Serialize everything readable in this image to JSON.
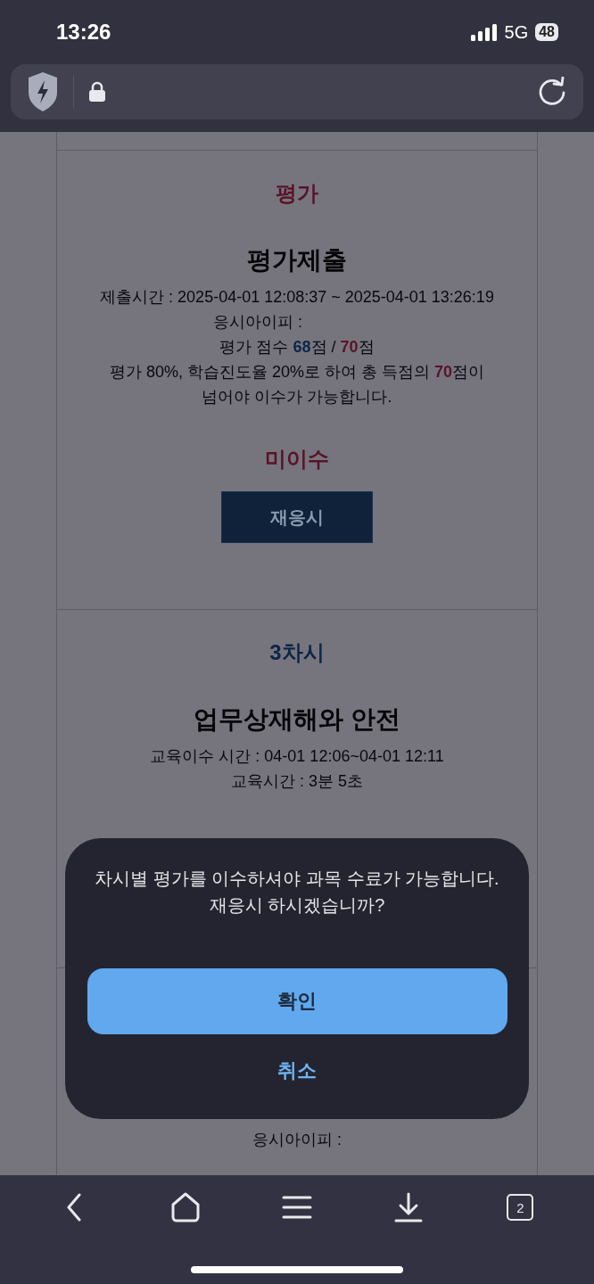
{
  "status_bar": {
    "time": "13:26",
    "network": "5G",
    "battery": "48"
  },
  "sections": [
    {
      "kind": "evaluation",
      "heading": "평가",
      "title": "평가제출",
      "lines": [
        "제출시간 : 2025-04-01 12:08:37 ~ 2025-04-01 13:26:19"
      ],
      "ip_label": "응시아이피 :",
      "score": "평가 점수 **68**점 / **70**점",
      "rule": "평가 80%, 학습진도율 20%로 하여 총 득점의 **70**점이 넘어야 이수가 가능합니다.",
      "result": "미이수",
      "action": "재응시"
    },
    {
      "kind": "lesson",
      "heading": "3차시",
      "title": "업무상재해와 안전",
      "lines": [
        "교육이수 시간 : 04-01 12:06~04-01 12:11",
        "교육시간 : 3분 5초"
      ]
    },
    {
      "kind": "partial",
      "ip_label": "응시아이피 :"
    }
  ],
  "dialog": {
    "message": "차시별 평가를 이수하셔야 과목 수료가 가능합니다. 재응시 하시겠습니까?",
    "confirm": "확인",
    "cancel": "취소"
  },
  "toolbar": {
    "tab_count": "2"
  }
}
